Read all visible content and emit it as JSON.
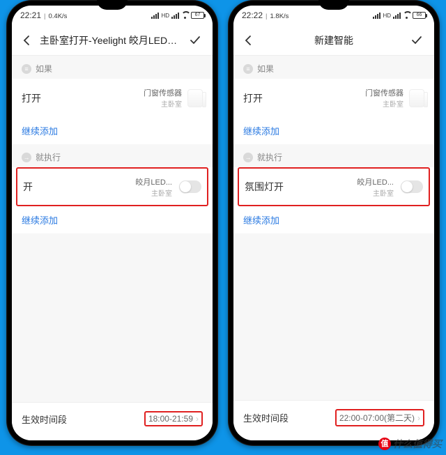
{
  "left": {
    "status": {
      "time": "22:21",
      "speed": "0.4K/s",
      "battery": "67"
    },
    "nav_title": "主卧室打开-Yeelight 皎月LED吸顶灯开",
    "if_label": "如果",
    "trigger": {
      "title": "打开",
      "device": "门窗传感器",
      "room": "主卧室"
    },
    "add_more": "继续添加",
    "then_label": "就执行",
    "action": {
      "title": "开",
      "device": "皎月LED...",
      "room": "主卧室"
    },
    "footer_label": "生效时间段",
    "footer_value": "18:00-21:59"
  },
  "right": {
    "status": {
      "time": "22:22",
      "speed": "1.8K/s",
      "battery": "66"
    },
    "nav_title": "新建智能",
    "if_label": "如果",
    "trigger": {
      "title": "打开",
      "device": "门窗传感器",
      "room": "主卧室"
    },
    "add_more": "继续添加",
    "then_label": "就执行",
    "action": {
      "title": "氛围灯开",
      "device": "皎月LED...",
      "room": "主卧室"
    },
    "footer_label": "生效时间段",
    "footer_value": "22:00-07:00(第二天)"
  },
  "watermark": "什么值得买"
}
